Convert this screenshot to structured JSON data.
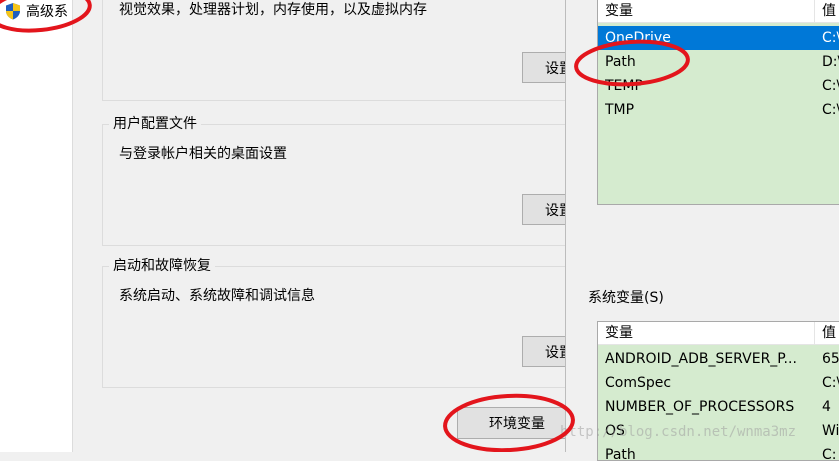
{
  "nav": {
    "item_label": "高级系",
    "icon": "uac-shield-icon"
  },
  "performance": {
    "description": "视觉效果，处理器计划，内存使用，以及虚拟内存",
    "settings_label": "设置"
  },
  "user_profiles": {
    "title": "用户配置文件",
    "description": "与登录帐户相关的桌面设置",
    "settings_label": "设置"
  },
  "startup_recovery": {
    "title": "启动和故障恢复",
    "description": "系统启动、系统故障和调试信息",
    "settings_label": "设置"
  },
  "env_button_label": "环境变量",
  "user_vars": {
    "columns": {
      "name": "变量",
      "value": "值"
    },
    "rows": [
      {
        "name": "OneDrive",
        "value": "C:\\",
        "selected": true
      },
      {
        "name": "Path",
        "value": "D:\\"
      },
      {
        "name": "TEMP",
        "value": "C:\\"
      },
      {
        "name": "TMP",
        "value": "C:\\"
      }
    ]
  },
  "system_vars": {
    "label": "系统变量(S)",
    "columns": {
      "name": "变量",
      "value": "值"
    },
    "rows": [
      {
        "name": "ANDROID_ADB_SERVER_P...",
        "value": "65"
      },
      {
        "name": "ComSpec",
        "value": "C:\\"
      },
      {
        "name": "NUMBER_OF_PROCESSORS",
        "value": "4"
      },
      {
        "name": "OS",
        "value": "Wi"
      },
      {
        "name": "Path",
        "value": "C:"
      }
    ]
  },
  "watermark": "http://blog.csdn.net/wnma3mz",
  "annotation_color": "#e3151c"
}
